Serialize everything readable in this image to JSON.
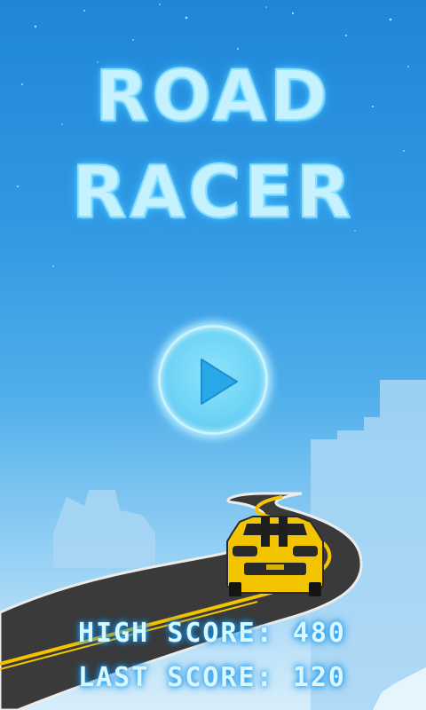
{
  "title": {
    "line1": "ROAD",
    "line2": "RACER"
  },
  "play_button": {
    "icon": "play-icon"
  },
  "scores": {
    "high_label": "HIGH SCORE:",
    "high_value": "480",
    "last_label": "LAST SCORE:",
    "last_value": "120"
  },
  "colors": {
    "sky_top": "#1f86d8",
    "sky_bottom": "#d7eefb",
    "title_glow": "#c6f2ff",
    "car_body": "#f2c500",
    "road": "#2b2b2b",
    "road_line": "#f5c400"
  }
}
